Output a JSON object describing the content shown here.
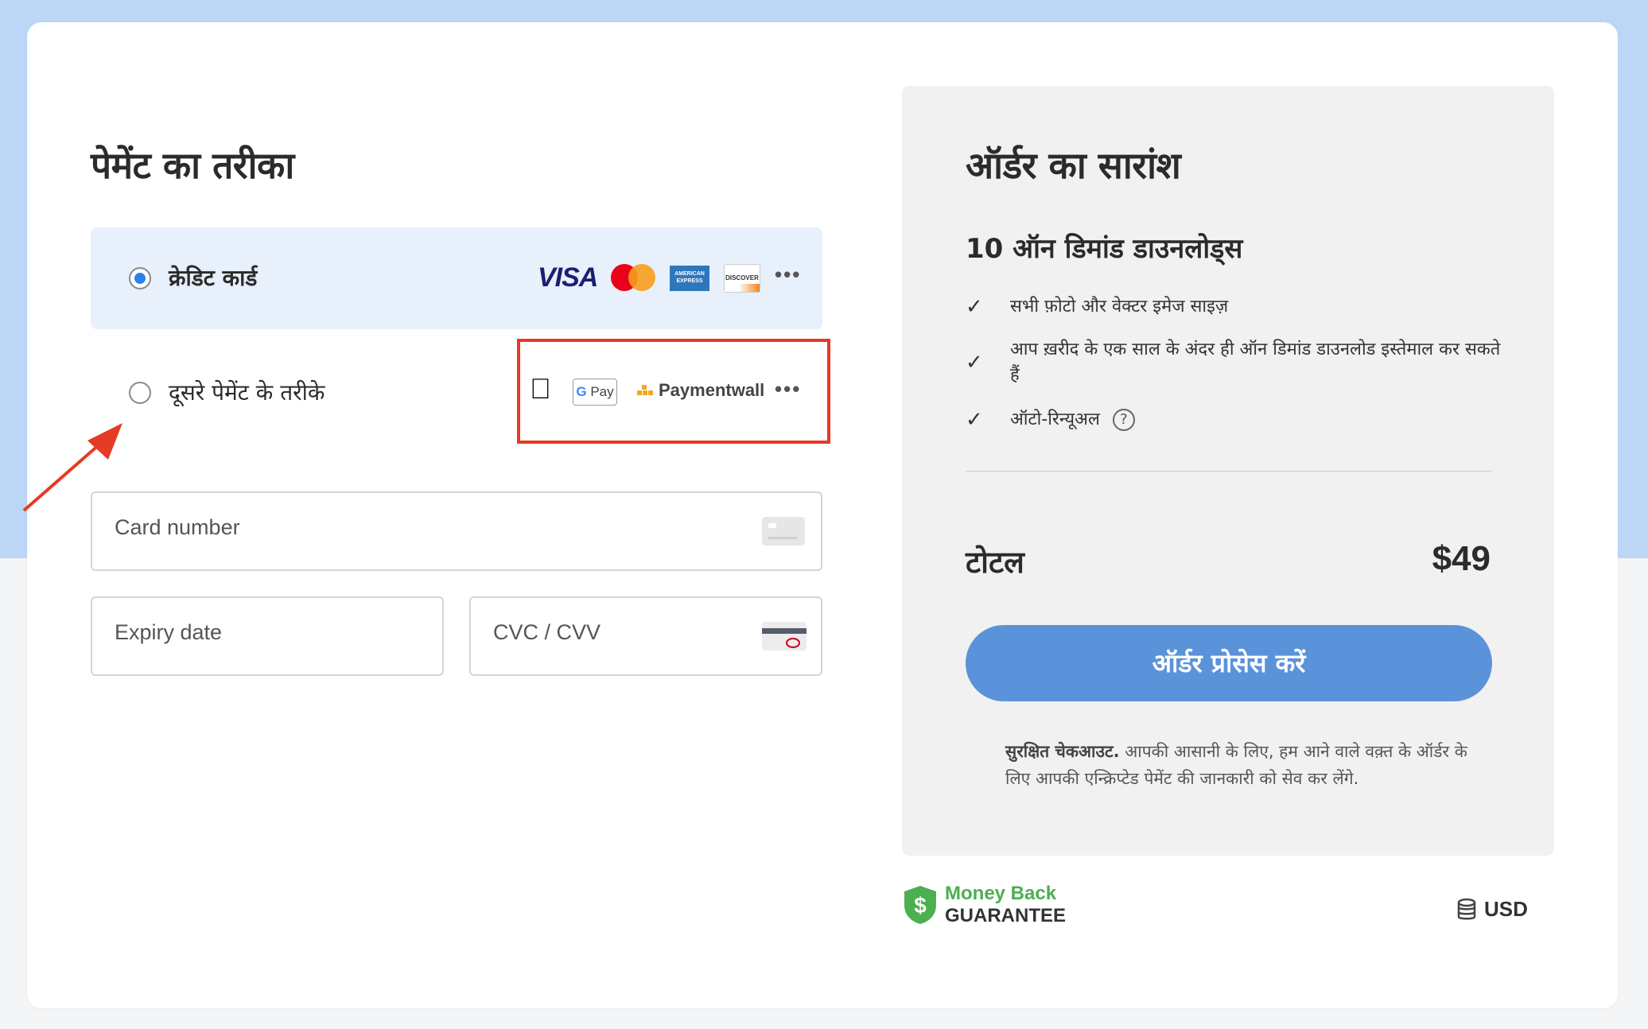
{
  "payment": {
    "title": "पेमेंट का तरीका",
    "credit_card": {
      "label": "क्रेडिट कार्ड",
      "brands": [
        "VISA",
        "mastercard",
        "AMERICAN EXPRESS",
        "DISCOVER"
      ],
      "more": "•••",
      "selected": true
    },
    "other_methods": {
      "label": "दूसरे पेमेंट के तरीके",
      "brands": [
        "apple-pay",
        "G Pay",
        "Paymentwall"
      ],
      "more": "•••",
      "selected": false
    },
    "fields": {
      "card_number": "Card number",
      "expiry": "Expiry date",
      "cvc": "CVC / CVV"
    }
  },
  "summary": {
    "title": "ऑर्डर का सारांश",
    "plan": "10 ऑन डिमांड डाउनलोड्स",
    "features": [
      "सभी फ़ोटो और वेक्टर इमेज साइज़",
      "आप ख़रीद के एक साल के अंदर ही ऑन डिमांड डाउनलोड इस्तेमाल कर सकते हैं",
      "ऑटो-रिन्यूअल"
    ],
    "help_icon": "?",
    "total_label": "टोटल",
    "total_value": "$49",
    "button": "ऑर्डर प्रोसेस करें",
    "secure_bold": "सुरक्षित चेकआउट.",
    "secure_text": " आपकी आसानी के लिए, हम आने वाले वक़्त के ऑर्डर के लिए आपकी एन्क्रिप्टेड पेमेंट की जानकारी को सेव कर लेंगे."
  },
  "footer": {
    "guarantee_line1": "Money Back",
    "guarantee_line2": "GUARANTEE",
    "currency": "USD"
  },
  "colors": {
    "accent": "#5b93da",
    "radio_selected": "#2f80ed",
    "highlight_box": "#e53a24",
    "guarantee_green": "#4caf50"
  }
}
